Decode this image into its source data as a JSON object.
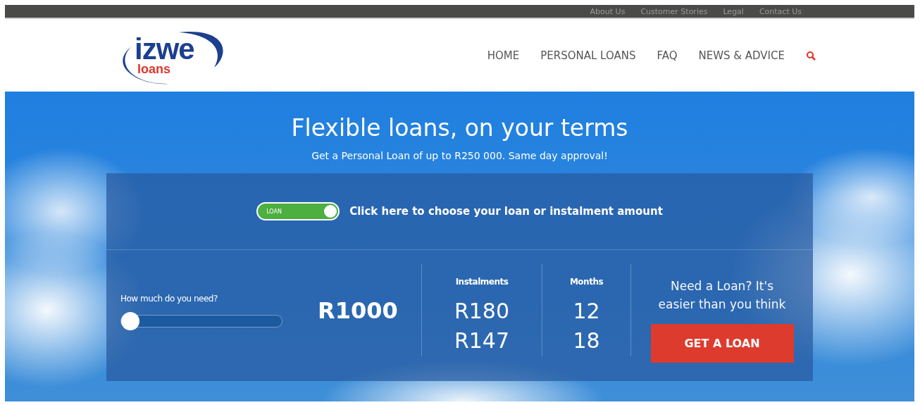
{
  "top_links": [
    "About Us",
    "Customer Stories",
    "Legal",
    "Contact Us"
  ],
  "logo": {
    "name": "izwe",
    "sub": "loans"
  },
  "nav": [
    "HOME",
    "PERSONAL LOANS",
    "FAQ",
    "NEWS & ADVICE"
  ],
  "hero": {
    "title": "Flexible loans, on your terms",
    "subtitle": "Get a Personal Loan of up to R250 000. Same day approval!"
  },
  "calculator": {
    "toggle": {
      "label": "LOAN",
      "on": true
    },
    "prompt": "Click here to choose your loan or instalment amount",
    "slider": {
      "label": "How much do you need?",
      "level": 0
    },
    "amount": "R1000",
    "columns": [
      {
        "heading": "Instalments",
        "values": [
          "R180",
          "R147"
        ]
      },
      {
        "heading": "Months",
        "values": [
          "12",
          "18"
        ]
      }
    ],
    "cta": {
      "text": "Need a Loan? It's easier than you think",
      "button": "GET A LOAN"
    }
  }
}
